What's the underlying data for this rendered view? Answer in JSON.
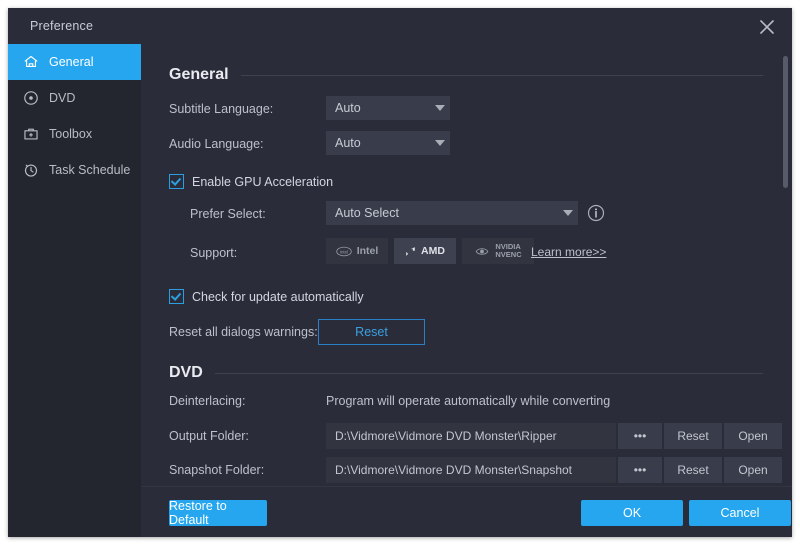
{
  "window": {
    "title": "Preference",
    "close_icon": "close-icon"
  },
  "sidebar": {
    "items": [
      {
        "label": "General",
        "icon": "home-icon",
        "active": true
      },
      {
        "label": "DVD",
        "icon": "disc-icon",
        "active": false
      },
      {
        "label": "Toolbox",
        "icon": "toolbox-icon",
        "active": false
      },
      {
        "label": "Task Schedule",
        "icon": "clock-icon",
        "active": false
      }
    ]
  },
  "general": {
    "heading": "General",
    "subtitle_language": {
      "label": "Subtitle Language:",
      "value": "Auto"
    },
    "audio_language": {
      "label": "Audio Language:",
      "value": "Auto"
    },
    "gpu_acceleration": {
      "label": "Enable GPU Acceleration",
      "checked": true
    },
    "prefer_select": {
      "label": "Prefer Select:",
      "value": "Auto Select",
      "info_icon": "info-icon"
    },
    "support": {
      "label": "Support:",
      "badges": [
        {
          "name": "Intel",
          "text": "Intel",
          "highlight": false
        },
        {
          "name": "AMD",
          "text": "AMD",
          "highlight": true
        },
        {
          "name": "NVIDIA",
          "text": "NVIDIA NVENC",
          "line1": "NVIDIA",
          "line2": "NVENC",
          "highlight": false
        }
      ],
      "learn_more": "Learn more>>"
    },
    "check_update": {
      "label": "Check for update automatically",
      "checked": true
    },
    "reset_dialogs": {
      "label": "Reset all dialogs warnings:",
      "button": "Reset"
    }
  },
  "dvd": {
    "heading": "DVD",
    "deinterlacing": {
      "label": "Deinterlacing:",
      "value": "Program will operate automatically while converting"
    },
    "output_folder": {
      "label": "Output Folder:",
      "value": "D:\\Vidmore\\Vidmore DVD Monster\\Ripper",
      "browse": "•••",
      "reset": "Reset",
      "open": "Open"
    },
    "snapshot_folder": {
      "label": "Snapshot Folder:",
      "value": "D:\\Vidmore\\Vidmore DVD Monster\\Snapshot",
      "browse": "•••",
      "reset": "Reset",
      "open": "Open"
    }
  },
  "footer": {
    "restore": "Restore to Default",
    "ok": "OK",
    "cancel": "Cancel"
  },
  "colors": {
    "accent": "#25a6ef",
    "window_bg": "#2a2d39",
    "sidebar_bg": "#24262f",
    "field_bg": "#32353f",
    "control_bg": "#393d4b"
  }
}
